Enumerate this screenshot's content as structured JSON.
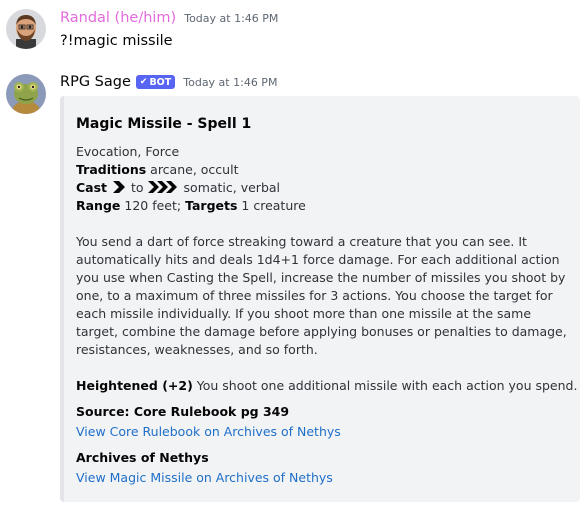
{
  "messages": [
    {
      "username": "Randal (he/him)",
      "timestamp": "Today at 1:46 PM",
      "text": "?!magic missile",
      "avatar_icon": "bearded-man-avatar",
      "username_color": "#e36bdc"
    },
    {
      "username": "RPG Sage",
      "badge": "BOT",
      "timestamp": "Today at 1:46 PM",
      "avatar_icon": "frog-knight-avatar",
      "username_color": "#060607",
      "badge_color": "#5865f2"
    }
  ],
  "embed": {
    "title": "Magic Missile -  Spell 1",
    "school_line": "Evocation, Force",
    "traditions_label": "Traditions",
    "traditions_value": " arcane, occult",
    "cast_label": "Cast",
    "cast_to": "to",
    "cast_components": "somatic, verbal",
    "action_icons": [
      "one-action-icon",
      "three-actions-icon"
    ],
    "range_label": "Range",
    "range_value": " 120 feet; ",
    "targets_label": "Targets",
    "targets_value": " 1 creature",
    "description": "You send a dart of force streaking toward a creature that you can see. It automatically hits and deals 1d4+1 force damage. For each additional action you use when Casting the Spell, increase the number of missiles you shoot by one, to a maximum of three missiles for 3 actions. You choose the target for each missile individually. If you shoot more than one missile at the same target, combine the damage before applying bonuses or penalties to damage, resistances, weaknesses, and so forth.",
    "heightened_label": "Heightened (+2)",
    "heightened_text": " You shoot one additional missile with each action you spend.",
    "source_text": "Source: Core Rulebook pg 349",
    "source_link": "View Core Rulebook on Archives of Nethys",
    "aon_title": "Archives of Nethys",
    "aon_link": "View Magic Missile on Archives of Nethys",
    "link_color": "#1f6fc9"
  }
}
